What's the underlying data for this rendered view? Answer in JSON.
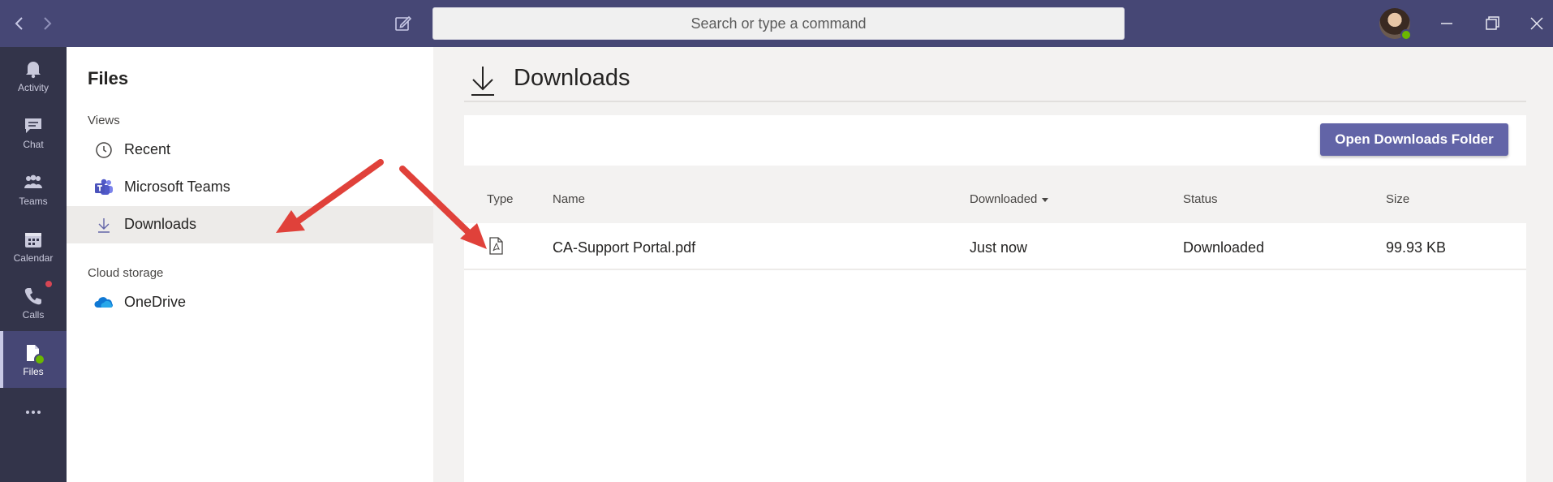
{
  "search": {
    "placeholder": "Search or type a command"
  },
  "rail": {
    "items": [
      {
        "label": "Activity",
        "icon": "bell-icon"
      },
      {
        "label": "Chat",
        "icon": "chat-icon"
      },
      {
        "label": "Teams",
        "icon": "teams-icon"
      },
      {
        "label": "Calendar",
        "icon": "calendar-icon"
      },
      {
        "label": "Calls",
        "icon": "phone-icon"
      },
      {
        "label": "Files",
        "icon": "files-icon"
      }
    ],
    "more_label": "more-options-icon"
  },
  "files_panel": {
    "title": "Files",
    "views_label": "Views",
    "views": [
      {
        "label": "Recent",
        "icon": "clock-icon"
      },
      {
        "label": "Microsoft Teams",
        "icon": "teams-logo-icon"
      },
      {
        "label": "Downloads",
        "icon": "download-icon"
      }
    ],
    "cloud_label": "Cloud storage",
    "cloud": [
      {
        "label": "OneDrive",
        "icon": "onedrive-cloud-icon"
      }
    ]
  },
  "main": {
    "title": "Downloads",
    "open_button": "Open Downloads Folder",
    "columns": {
      "type": "Type",
      "name": "Name",
      "downloaded": "Downloaded",
      "status": "Status",
      "size": "Size"
    },
    "rows": [
      {
        "type_icon": "pdf-file-icon",
        "name": "CA-Support Portal.pdf",
        "downloaded": "Just now",
        "status": "Downloaded",
        "size": "99.93 KB"
      }
    ]
  },
  "colors": {
    "titlebar": "#464775",
    "rail": "#33344a",
    "accent": "#6264a7",
    "annotation_arrow": "#e0413a"
  }
}
